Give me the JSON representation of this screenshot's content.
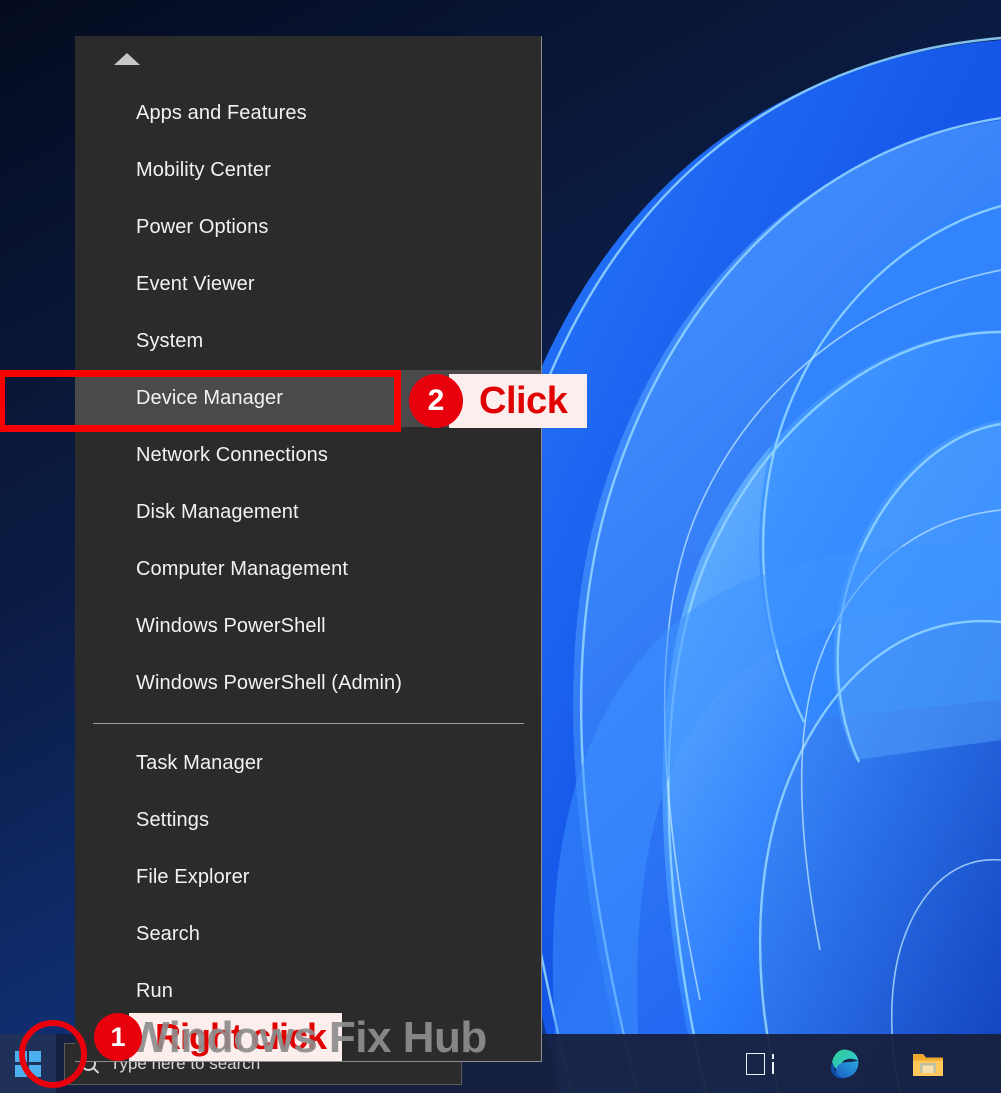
{
  "desktop": {
    "wallpaper_name": "windows-11-bloom-wallpaper",
    "colors": {
      "wallpaper_dark": "#061129",
      "wallpaper_blue": "#1a6ef5",
      "wallpaper_light_blue": "#63b8ff",
      "menu_background": "#2b2b2b",
      "menu_highlight": "#4a4a4a",
      "menu_text": "#f2f2f2",
      "accent_red": "#e8000d",
      "callout_pill_background": "#fdeeee",
      "taskbar_background": "#16203e"
    }
  },
  "winx_menu": {
    "name": "Win+X quick link menu",
    "scroll_up_icon": "triangle-up-icon",
    "items": [
      {
        "label": "Apps and Features",
        "highlighted": false
      },
      {
        "label": "Mobility Center",
        "highlighted": false
      },
      {
        "label": "Power Options",
        "highlighted": false
      },
      {
        "label": "Event Viewer",
        "highlighted": false
      },
      {
        "label": "System",
        "highlighted": false
      },
      {
        "label": "Device Manager",
        "highlighted": true
      },
      {
        "label": "Network Connections",
        "highlighted": false
      },
      {
        "label": "Disk Management",
        "highlighted": false
      },
      {
        "label": "Computer Management",
        "highlighted": false
      },
      {
        "label": "Windows PowerShell",
        "highlighted": false
      },
      {
        "label": "Windows PowerShell (Admin)",
        "highlighted": false
      }
    ],
    "items_after_separator": [
      {
        "label": "Task Manager",
        "highlighted": false
      },
      {
        "label": "Settings",
        "highlighted": false
      },
      {
        "label": "File Explorer",
        "highlighted": false
      },
      {
        "label": "Search",
        "highlighted": false
      },
      {
        "label": "Run",
        "highlighted": false
      }
    ]
  },
  "callouts": [
    {
      "number": "1",
      "label": "Right click",
      "target": "start-button"
    },
    {
      "number": "2",
      "label": "Click",
      "target": "device-manager-menu-item"
    }
  ],
  "taskbar": {
    "start_button_icon": "windows-logo-icon",
    "search": {
      "placeholder": "Type here to search",
      "icon": "search-icon"
    },
    "tray": [
      {
        "name": "task-view-icon",
        "label": "Task View"
      },
      {
        "name": "microsoft-edge-icon",
        "label": "Microsoft Edge"
      },
      {
        "name": "file-explorer-icon",
        "label": "File Explorer"
      }
    ]
  },
  "watermark": {
    "text": "Windows Fix Hub"
  }
}
